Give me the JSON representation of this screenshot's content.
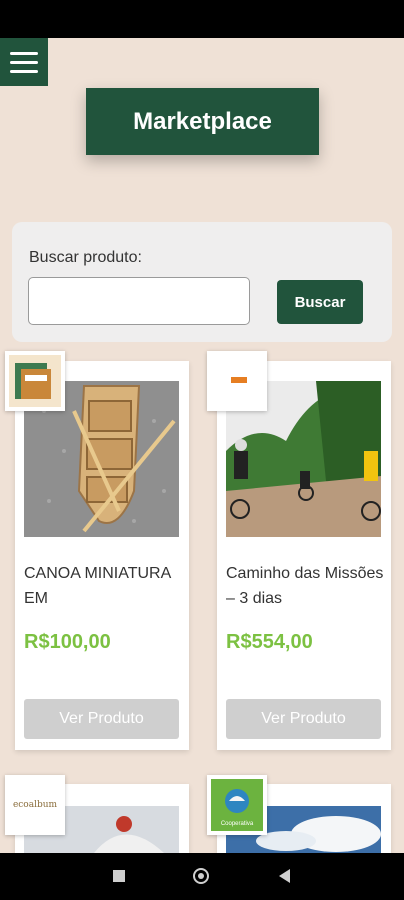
{
  "header": {
    "title": "Marketplace"
  },
  "search": {
    "label": "Buscar produto:",
    "value": "",
    "button_label": "Buscar"
  },
  "products": [
    {
      "name": "CANOA MINIATURA EM",
      "price": "R$100,00",
      "button_label": "Ver Produto"
    },
    {
      "name": "Caminho das Missões – 3 dias",
      "price": "R$554,00",
      "button_label": "Ver Produto"
    }
  ],
  "partial_cards": [
    {
      "logo_text": "ecoalbum"
    },
    {
      "logo_text": "Cooperativa"
    }
  ],
  "colors": {
    "primary": "#21543c",
    "price": "#7cc142",
    "background": "#efe1d6",
    "disabled_button": "#cfcfcf"
  }
}
